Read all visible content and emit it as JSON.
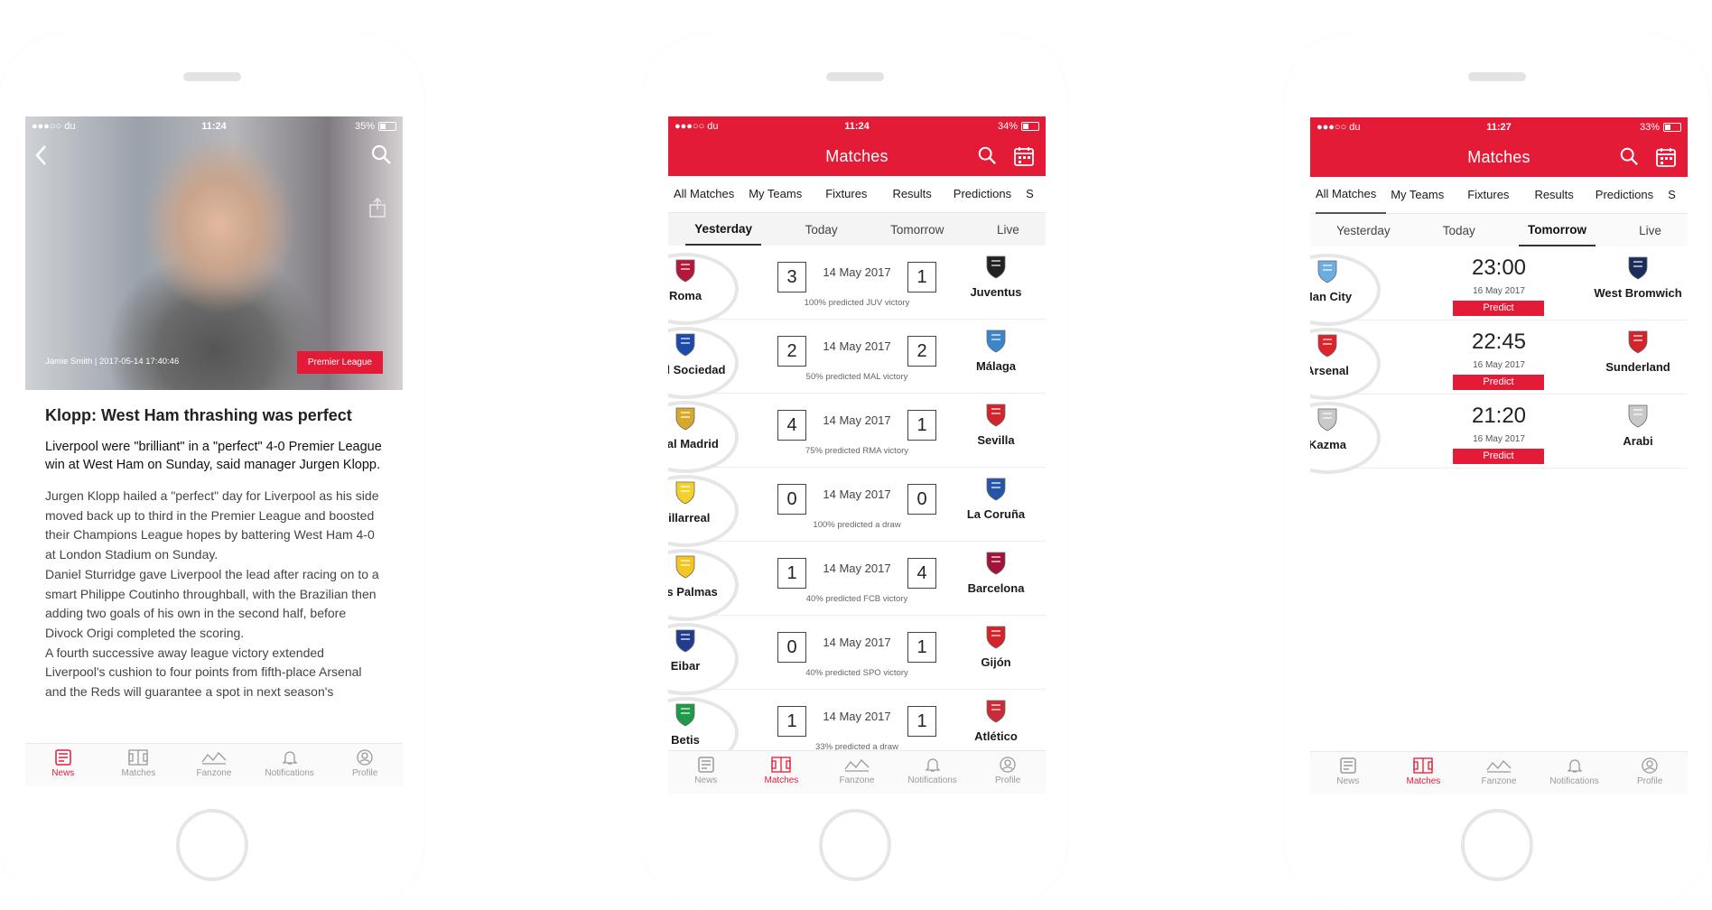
{
  "status_bars": [
    {
      "carrier": "●●●○○ du",
      "time": "11:24",
      "battery": "35%",
      "battery_level": 0.35
    },
    {
      "carrier": "●●●○○ du",
      "time": "11:24",
      "battery": "34%",
      "battery_level": 0.34
    },
    {
      "carrier": "●●●○○ du",
      "time": "11:27",
      "battery": "33%",
      "battery_level": 0.33
    }
  ],
  "colors": {
    "accent": "#e31b37",
    "muted": "#9a9a9a"
  },
  "article": {
    "credit": "Jamie Smith | 2017-05-14 17:40:46",
    "tag": "Premier League",
    "title": "Klopp: West Ham thrashing was perfect",
    "lead": "Liverpool were \"brilliant\" in a \"perfect\" 4-0 Premier League win at West Ham on Sunday, said manager Jurgen Klopp.",
    "body": [
      "Jurgen Klopp hailed a \"perfect\" day for Liverpool as his side moved back up to third in the Premier League and boosted their Champions League hopes by battering West Ham 4-0 at London Stadium on Sunday.",
      "Daniel Sturridge gave Liverpool the lead after racing on to a smart Philippe Coutinho throughball, with the Brazilian then adding two goals of his own in the second half, before Divock Origi completed the scoring.",
      "A fourth successive away league victory extended Liverpool's cushion to four points from fifth-place Arsenal and the Reds will guarantee a spot in next season's Champions League with a win over"
    ]
  },
  "matches_screen": {
    "title": "Matches",
    "tabs": [
      "All Matches",
      "My Teams",
      "Fixtures",
      "Results",
      "Predictions",
      "S"
    ],
    "days": [
      "Yesterday",
      "Today",
      "Tomorrow",
      "Live"
    ]
  },
  "yesterday_matches": [
    {
      "home": "Roma",
      "away": "Juventus",
      "home_score": "3",
      "away_score": "1",
      "date": "14 May 2017",
      "prediction": "100% predicted JUV victory",
      "home_color": "#b5173b",
      "away_color": "#222222"
    },
    {
      "home": "Real Sociedad",
      "away": "Málaga",
      "home_score": "2",
      "away_score": "2",
      "date": "14 May 2017",
      "prediction": "50% predicted MAL victory",
      "home_color": "#1d4aa8",
      "away_color": "#3a86c8"
    },
    {
      "home": "Real Madrid",
      "away": "Sevilla",
      "home_score": "4",
      "away_score": "1",
      "date": "14 May 2017",
      "prediction": "75% predicted RMA victory",
      "home_color": "#d6a92b",
      "away_color": "#d3232b"
    },
    {
      "home": "Villarreal",
      "away": "La Coruña",
      "home_score": "0",
      "away_score": "0",
      "date": "14 May 2017",
      "prediction": "100% predicted a draw",
      "home_color": "#f2d22a",
      "away_color": "#2456a6"
    },
    {
      "home": "Las Palmas",
      "away": "Barcelona",
      "home_score": "1",
      "away_score": "4",
      "date": "14 May 2017",
      "prediction": "40% predicted FCB victory",
      "home_color": "#f4c61f",
      "away_color": "#a3123a"
    },
    {
      "home": "Eibar",
      "away": "Gijón",
      "home_score": "0",
      "away_score": "1",
      "date": "14 May 2017",
      "prediction": "40% predicted SPO victory",
      "home_color": "#1f3d8c",
      "away_color": "#d3232b"
    },
    {
      "home": "Betis",
      "away": "Atlético",
      "home_score": "1",
      "away_score": "1",
      "date": "14 May 2017",
      "prediction": "33% predicted a draw",
      "home_color": "#1d9a4a",
      "away_color": "#cb2a36"
    }
  ],
  "tomorrow_matches": [
    {
      "home": "Man City",
      "away": "West Bromwich",
      "time": "23:00",
      "date": "16 May 2017",
      "button": "Predict",
      "home_color": "#6caee0",
      "away_color": "#1c2c5b"
    },
    {
      "home": "Arsenal",
      "away": "Sunderland",
      "time": "22:45",
      "date": "16 May 2017",
      "button": "Predict",
      "home_color": "#e0222a",
      "away_color": "#d3232b"
    },
    {
      "home": "Kazma",
      "away": "Arabi",
      "time": "21:20",
      "date": "16 May 2017",
      "button": "Predict",
      "home_color": "#c9c9c9",
      "away_color": "#c9c9c9"
    }
  ],
  "bottom_nav": [
    "News",
    "Matches",
    "Fanzone",
    "Notifications",
    "Profile"
  ]
}
